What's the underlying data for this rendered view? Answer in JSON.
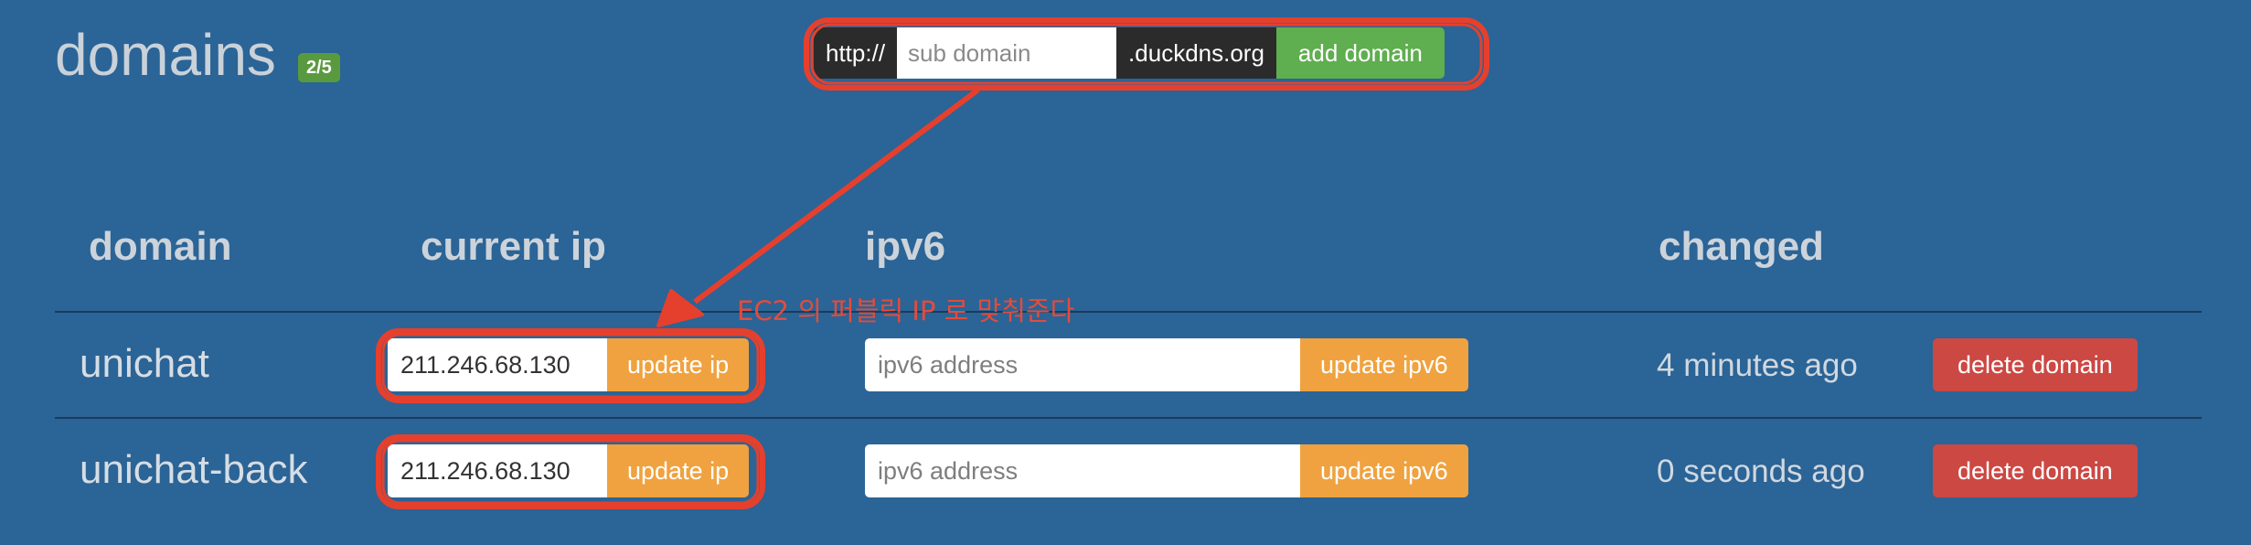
{
  "header": {
    "title": "domains",
    "count_badge": "2/5"
  },
  "add_form": {
    "prefix": "http://",
    "subdomain_placeholder": "sub domain",
    "suffix": ".duckdns.org",
    "add_label": "add domain"
  },
  "table": {
    "columns": [
      "domain",
      "current ip",
      "ipv6",
      "changed"
    ],
    "rows": [
      {
        "domain": "unichat",
        "current_ip": "211.246.68.130",
        "update_ip_label": "update ip",
        "ipv6_placeholder": "ipv6 address",
        "update_ipv6_label": "update ipv6",
        "changed": "4 minutes ago",
        "delete_label": "delete domain"
      },
      {
        "domain": "unichat-back",
        "current_ip": "211.246.68.130",
        "update_ip_label": "update ip",
        "ipv6_placeholder": "ipv6 address",
        "update_ipv6_label": "update ipv6",
        "changed": "0 seconds ago",
        "delete_label": "delete domain"
      }
    ]
  },
  "annotation": {
    "note": "EC2 의 퍼블릭 IP 로 맞춰준다",
    "color": "#e54b3b"
  }
}
